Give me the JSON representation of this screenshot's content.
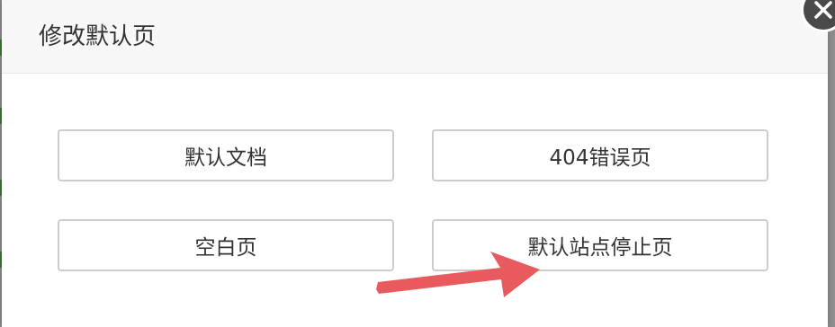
{
  "dialog": {
    "title": "修改默认页",
    "options": [
      {
        "label": "默认文档"
      },
      {
        "label": "404错误页"
      },
      {
        "label": "空白页"
      },
      {
        "label": "默认站点停止页"
      }
    ]
  },
  "colors": {
    "annotation_arrow": "#e85a5e",
    "close_button": "#4a4a4a",
    "backdrop_green_mark": "#3a7a2e"
  },
  "icons": {
    "close": "close-icon",
    "annotation": "arrow-annotation"
  }
}
